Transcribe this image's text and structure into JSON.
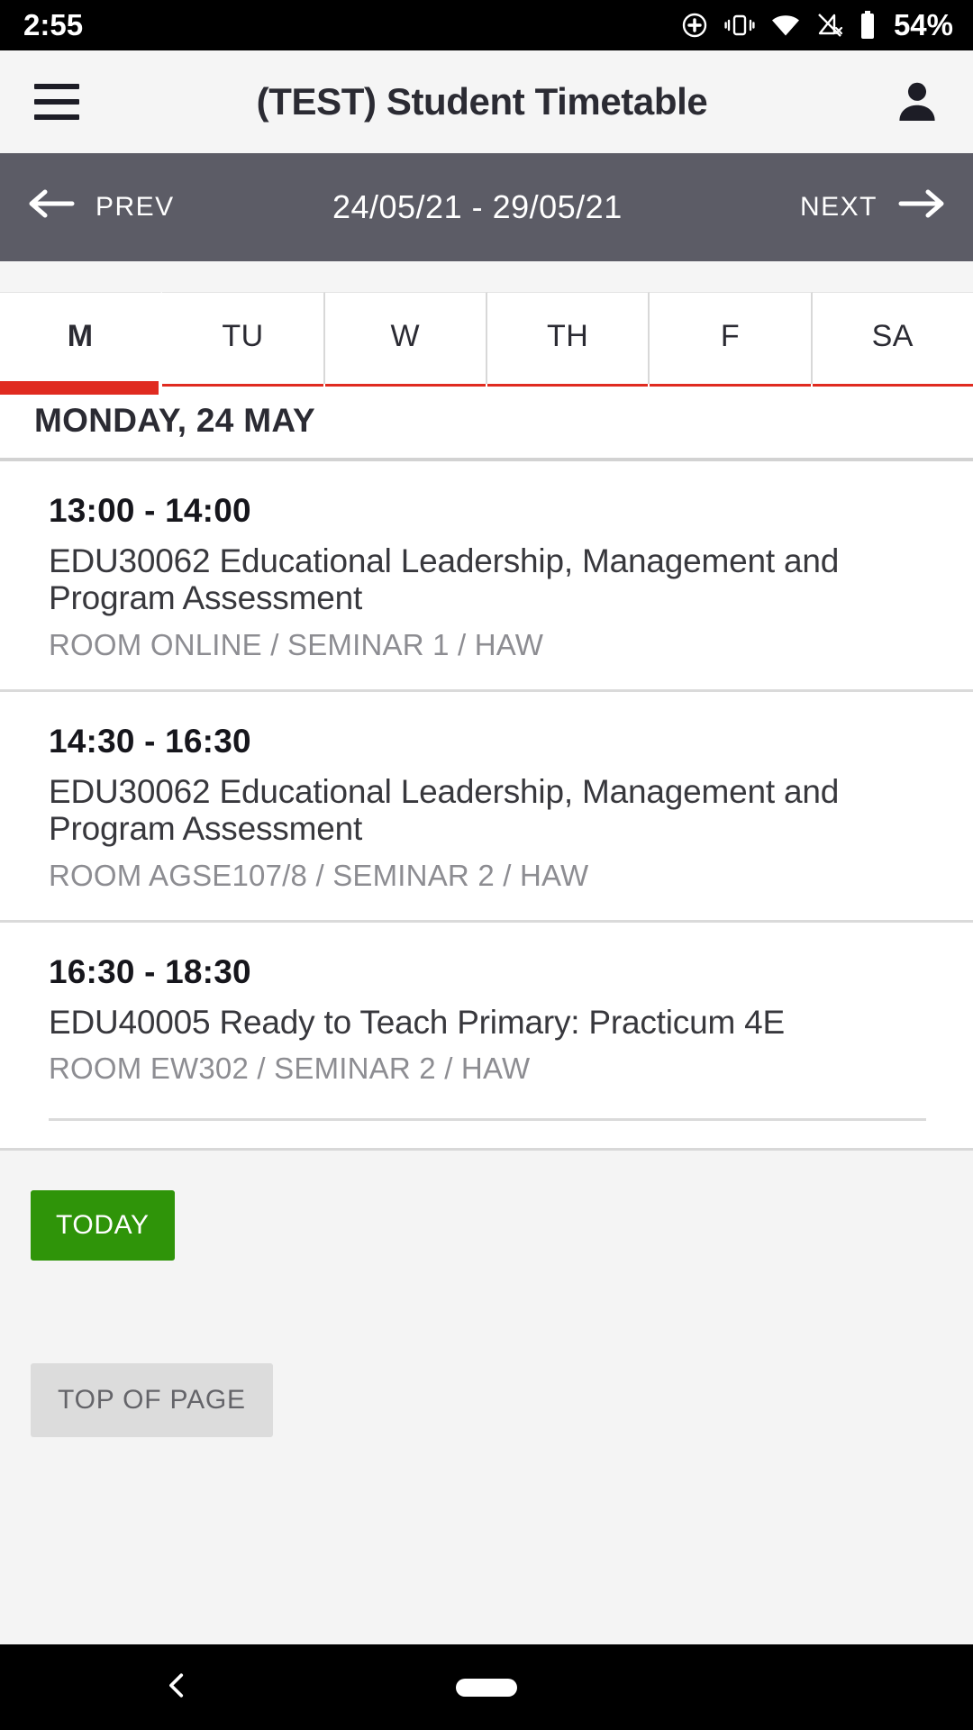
{
  "status_bar": {
    "time": "2:55",
    "battery_percent": "54%",
    "icons": [
      "location-icon",
      "vibrate-icon",
      "wifi-icon",
      "signal-off-icon",
      "battery-icon"
    ]
  },
  "app_bar": {
    "menu_icon": "hamburger-menu-icon",
    "title": "(TEST) Student Timetable",
    "account_icon": "person-icon"
  },
  "week_nav": {
    "prev_label": "PREV",
    "prev_icon": "arrow-left-icon",
    "date_range": "24/05/21 - 29/05/21",
    "next_label": "NEXT",
    "next_icon": "arrow-right-icon",
    "background_color": "#5c5c66"
  },
  "day_tabs": {
    "active_index": 0,
    "active_color": "#e02b20",
    "items": [
      {
        "label": "M",
        "active": true
      },
      {
        "label": "TU",
        "active": false
      },
      {
        "label": "W",
        "active": false
      },
      {
        "label": "TH",
        "active": false
      },
      {
        "label": "F",
        "active": false
      },
      {
        "label": "SA",
        "active": false
      }
    ]
  },
  "day_heading": "MONDAY, 24 MAY",
  "events": [
    {
      "time": "13:00 - 14:00",
      "title": "EDU30062 Educational Leadership, Management and Program Assessment",
      "room": "ROOM ONLINE / SEMINAR 1 / HAW"
    },
    {
      "time": "14:30 - 16:30",
      "title": "EDU30062 Educational Leadership, Management and Program Assessment",
      "room": "ROOM AGSE107/8 / SEMINAR 2 / HAW"
    },
    {
      "time": "16:30 - 18:30",
      "title": "EDU40005 Ready to Teach Primary: Practicum 4E",
      "room": "ROOM EW302 / SEMINAR 2 / HAW"
    }
  ],
  "footer": {
    "today_label": "TODAY",
    "today_color": "#2f9409",
    "top_of_page_label": "TOP OF PAGE",
    "top_of_page_color": "#dcdcdc"
  },
  "system_nav": {
    "back_icon": "chevron-left-icon",
    "home_icon": "home-pill-icon"
  }
}
